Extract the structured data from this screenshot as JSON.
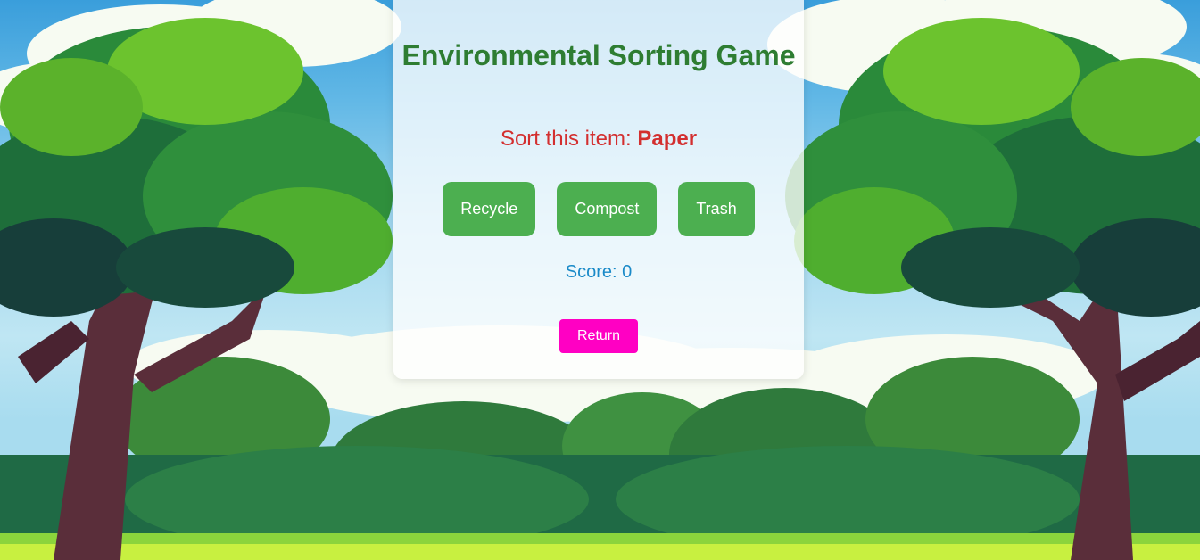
{
  "game": {
    "title": "Environmental Sorting Game",
    "prompt_label": "Sort this item:",
    "current_item": "Paper",
    "choices": [
      "Recycle",
      "Compost",
      "Trash"
    ],
    "score_label": "Score: 0",
    "return_label": "Return"
  },
  "colors": {
    "title": "#2e7d32",
    "prompt": "#d32f2f",
    "choice_button": "#4caf50",
    "score": "#1a8ac8",
    "return_button": "#ff00c3"
  }
}
